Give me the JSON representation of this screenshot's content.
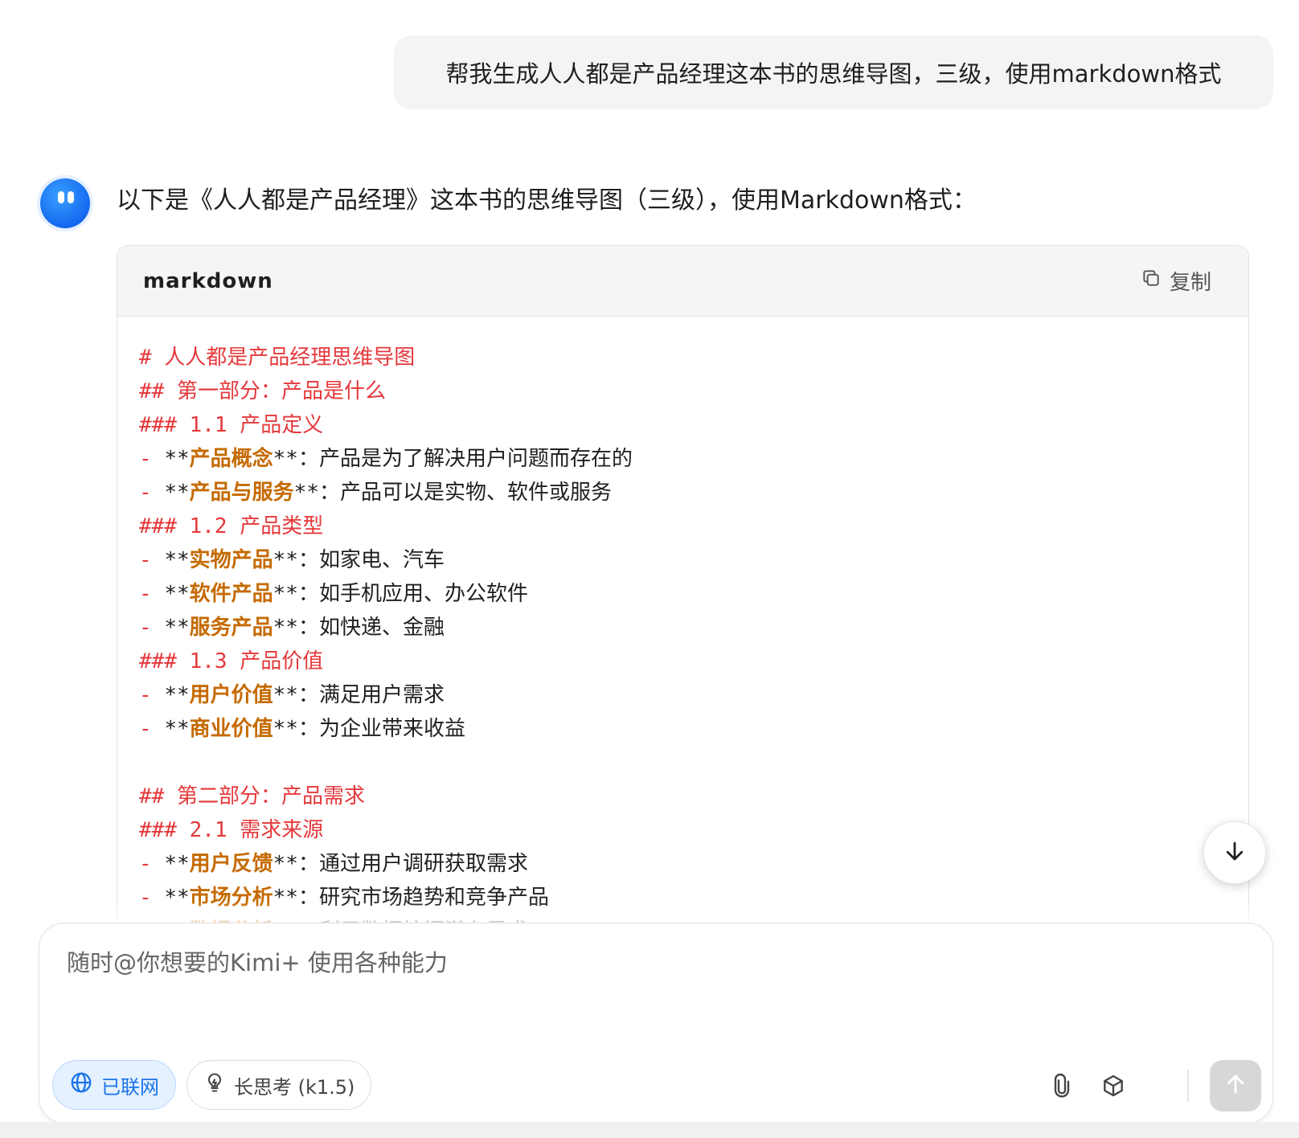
{
  "user_message": "帮我生成人人都是产品经理这本书的思维导图，三级，使用markdown格式",
  "assistant": {
    "intro": "以下是《人人都是产品经理》这本书的思维导图（三级），使用Markdown格式："
  },
  "code_block": {
    "language": "markdown",
    "copy_label": "复制",
    "lines": [
      {
        "type": "heading",
        "text": "# 人人都是产品经理思维导图"
      },
      {
        "type": "heading",
        "text": "## 第一部分：产品是什么"
      },
      {
        "type": "heading",
        "text": "### 1.1 产品定义"
      },
      {
        "type": "item",
        "bold": "产品概念",
        "rest": "：产品是为了解决用户问题而存在的"
      },
      {
        "type": "item",
        "bold": "产品与服务",
        "rest": "：产品可以是实物、软件或服务"
      },
      {
        "type": "heading",
        "text": "### 1.2 产品类型"
      },
      {
        "type": "item",
        "bold": "实物产品",
        "rest": "：如家电、汽车"
      },
      {
        "type": "item",
        "bold": "软件产品",
        "rest": "：如手机应用、办公软件"
      },
      {
        "type": "item",
        "bold": "服务产品",
        "rest": "：如快递、金融"
      },
      {
        "type": "heading",
        "text": "### 1.3 产品价值"
      },
      {
        "type": "item",
        "bold": "用户价值",
        "rest": "：满足用户需求"
      },
      {
        "type": "item",
        "bold": "商业价值",
        "rest": "：为企业带来收益"
      },
      {
        "type": "blank",
        "text": ""
      },
      {
        "type": "heading",
        "text": "## 第二部分：产品需求"
      },
      {
        "type": "heading",
        "text": "### 2.1 需求来源"
      },
      {
        "type": "item",
        "bold": "用户反馈",
        "rest": "：通过用户调研获取需求"
      },
      {
        "type": "item",
        "bold": "市场分析",
        "rest": "：研究市场趋势和竞争产品"
      },
      {
        "type": "item",
        "bold": "数据分析",
        "rest": "：利用数据挖掘潜在需求"
      }
    ]
  },
  "composer": {
    "placeholder": "随时@你想要的Kimi+ 使用各种能力",
    "web_label": "已联网",
    "think_label": "长思考 (k1.5)"
  },
  "icons": {
    "copy": "copy-icon",
    "scroll": "arrow-down-icon",
    "web": "globe-icon",
    "think": "lightbulb-icon",
    "attach": "paperclip-icon",
    "cube": "cube-icon",
    "send": "arrow-up-icon"
  },
  "colors": {
    "heading": "#e5383b",
    "bold": "#c56a00",
    "accent": "#1a73e8",
    "avatar": "#1468f0"
  }
}
